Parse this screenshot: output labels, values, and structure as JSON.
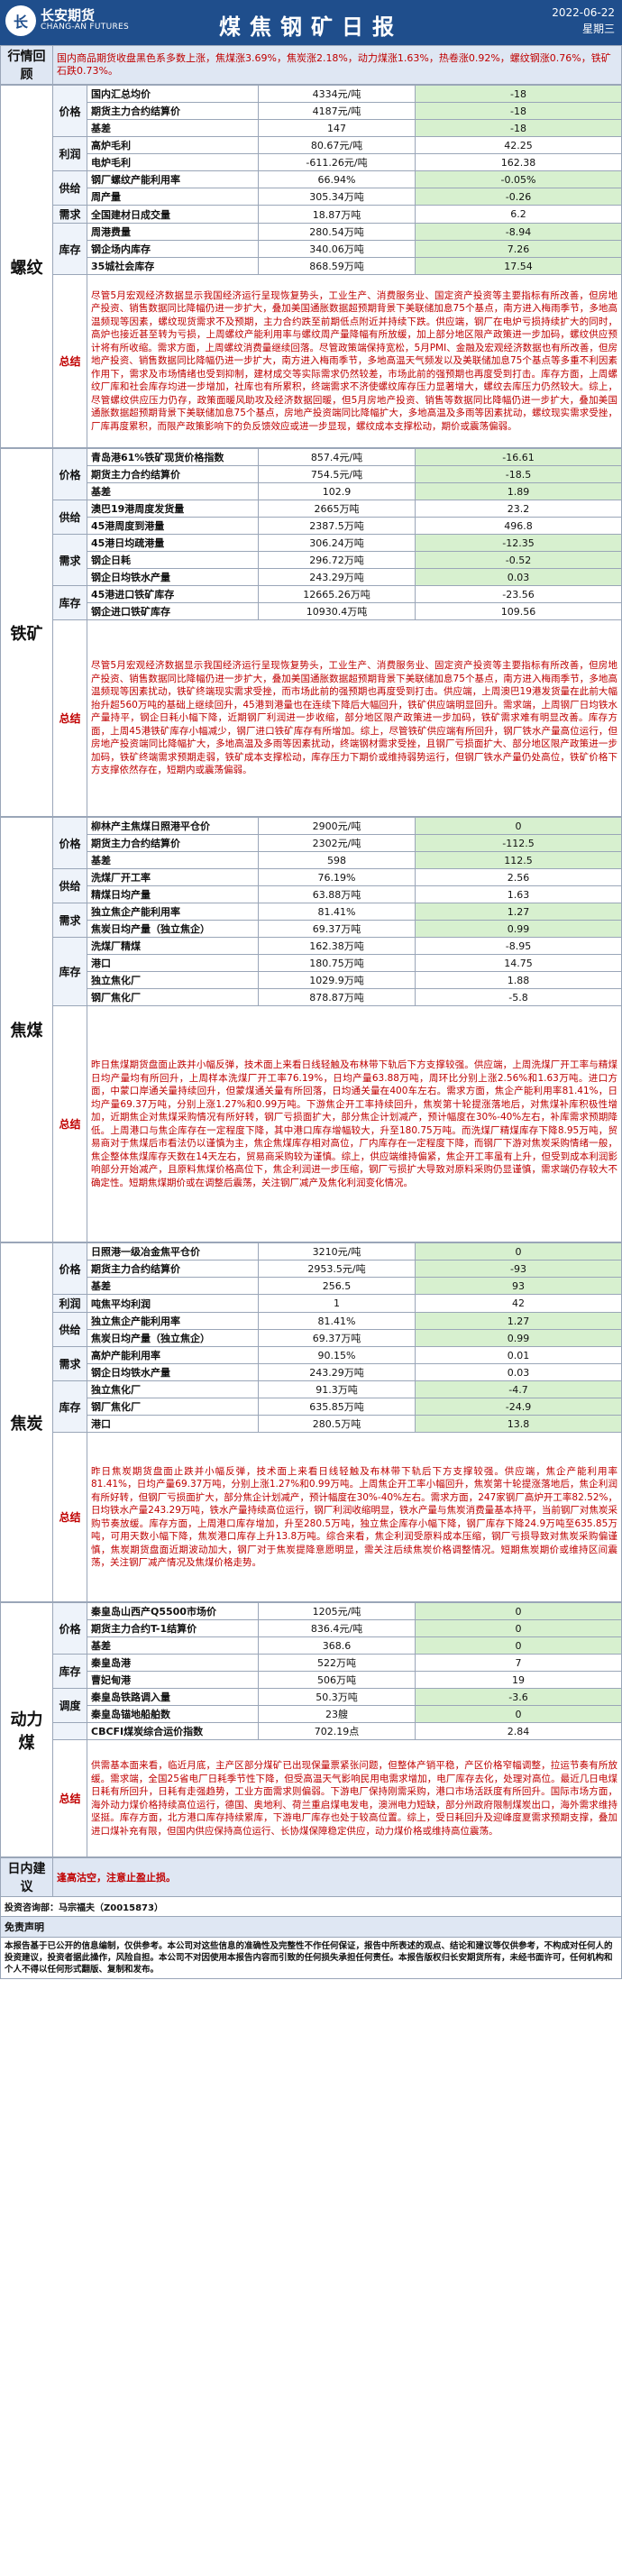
{
  "header": {
    "logo_mark": "长",
    "logo_cn": "长安期货",
    "logo_en": "CHANG-AN FUTURES",
    "title": "煤焦钢矿日报",
    "date": "2022-06-22",
    "weekday": "星期三"
  },
  "review": {
    "label": "行情回顾",
    "text": "国内商品期货收盘黑色系多数上涨，焦煤涨3.69%，焦炭涨2.18%，动力煤涨1.63%，热卷涨0.92%，螺纹钢涨0.76%，铁矿石跌0.73%。"
  },
  "sections": [
    {
      "name": "螺纹",
      "groups": [
        {
          "label": "价格",
          "rows": [
            {
              "item": "国内汇总均价",
              "value": "4334元/吨",
              "change": "-18"
            },
            {
              "item": "期货主力合约结算价",
              "value": "4187元/吨",
              "change": "-18"
            },
            {
              "item": "基差",
              "value": "147",
              "change": "-18"
            }
          ]
        },
        {
          "label": "利润",
          "rows": [
            {
              "item": "高炉毛利",
              "value": "80.67元/吨",
              "change": "42.25"
            },
            {
              "item": "电炉毛利",
              "value": "-611.26元/吨",
              "change": "162.38"
            }
          ]
        },
        {
          "label": "供给",
          "rows": [
            {
              "item": "钢厂螺纹产能利用率",
              "value": "66.94%",
              "change": "-0.05%"
            },
            {
              "item": "周产量",
              "value": "305.34万吨",
              "change": "-0.26"
            }
          ]
        },
        {
          "label": "需求",
          "rows": [
            {
              "item": "全国建材日成交量",
              "value": "18.87万吨",
              "change": "6.2"
            }
          ]
        },
        {
          "label": "库存",
          "rows": [
            {
              "item": "周港费量",
              "value": "280.54万吨",
              "change": "-8.94"
            },
            {
              "item": "钢企场内库存",
              "value": "340.06万吨",
              "change": "7.26"
            },
            {
              "item": "35城社会库存",
              "value": "868.59万吨",
              "change": "17.54"
            }
          ]
        }
      ],
      "summary_label": "总结",
      "summary": "尽管5月宏观经济数据显示我国经济运行呈现恢复势头，工业生产、消费服务业、国定资产投资等主要指标有所改善，但房地产投资、销售数据同比降幅仍进一步扩大，叠加美国通胀数据超预期背景下美联储加息75个基点，南方进入梅雨季节，多地高温频现等因素，螺纹现货需求不及预期，主力合约跌至前期低点附近并持续下跌。供应端，钢厂在电炉亏损持续扩大的同时，高炉也接近甚至转为亏损，上周螺纹产能利用率与螺纹周产量降幅有所放缓，加上部分地区限产政策进一步加码，螺纹供应预计将有所收缩。需求方面，上周螺纹消费量继续回落。尽管政策端保持宽松，5月PMI、金融及宏观经济数据也有所改善，但房地产投资、销售数据同比降幅仍进一步扩大，南方进入梅雨季节，多地高温天气频发以及美联储加息75个基点等多重不利因素作用下，需求及市场情绪也受到抑制，建材成交等实际需求仍然较差，市场此前的强预期也再度受到打击。库存方面，上周螺纹厂库和社会库存均进一步增加，社库也有所累积，终端需求不济使螺纹库存压力显著增大，螺纹去库压力仍然较大。综上，尽管螺纹供应压力仍存，政策面暖风助攻及经济数据回暖，但5月房地产投资、销售等数据同比降幅仍进一步扩大，叠加美国通胀数据超预期背景下美联储加息75个基点，房地产投资端同比降幅扩大，多地高温及多雨等因素扰动，螺纹现实需求受挫，厂库再度累积，而限产政策影响下的负反馈效应或进一步显现，螺纹成本支撑松动，期价或震荡偏弱。"
    },
    {
      "name": "铁矿",
      "groups": [
        {
          "label": "价格",
          "rows": [
            {
              "item": "青岛港61%铁矿现货价格指数",
              "value": "857.4元/吨",
              "change": "-16.61"
            },
            {
              "item": "期货主力合约结算价",
              "value": "754.5元/吨",
              "change": "-18.5"
            },
            {
              "item": "基差",
              "value": "102.9",
              "change": "1.89"
            }
          ]
        },
        {
          "label": "供给",
          "rows": [
            {
              "item": "澳巴19港周度发货量",
              "value": "2665万吨",
              "change": "23.2"
            },
            {
              "item": "45港周度到港量",
              "value": "2387.5万吨",
              "change": "496.8"
            }
          ]
        },
        {
          "label": "需求",
          "rows": [
            {
              "item": "45港日均疏港量",
              "value": "306.24万吨",
              "change": "-12.35"
            },
            {
              "item": "钢企日耗",
              "value": "296.72万吨",
              "change": "-0.52"
            },
            {
              "item": "钢企日均铁水产量",
              "value": "243.29万吨",
              "change": "0.03"
            }
          ]
        },
        {
          "label": "库存",
          "rows": [
            {
              "item": "45港进口铁矿库存",
              "value": "12665.26万吨",
              "change": "-23.56"
            },
            {
              "item": "钢企进口铁矿库存",
              "value": "10930.4万吨",
              "change": "109.56"
            }
          ]
        }
      ],
      "summary_label": "总结",
      "summary": "尽管5月宏观经济数据显示我国经济运行呈现恢复势头，工业生产、消费服务业、固定资产投资等主要指标有所改善，但房地产投资、销售数据同比降幅仍进一步扩大，叠加美国通胀数据超预期背景下美联储加息75个基点，南方进入梅雨季节，多地高温频现等因素扰动，铁矿终端现实需求受挫，而市场此前的强预期也再度受到打击。供应端，上周澳巴19港发货量在此前大幅抬升超560万吨的基础上继续回升，45港到港量也在连续下降后大幅回升，铁矿供应端明显回升。需求端，上周钢厂日均铁水产量持平，钢企日耗小幅下降，近期钢厂利润进一步收缩，部分地区限产政策进一步加码，铁矿需求难有明显改善。库存方面，上周45港铁矿库存小幅减少，钢厂进口铁矿库存有所增加。综上，尽管铁矿供应端有所回升，钢厂铁水产量高位运行，但房地产投资端同比降幅扩大，多地高温及多雨等因素扰动，终端钢材需求受挫，且钢厂亏损面扩大、部分地区限产政策进一步加码，铁矿终端需求预期走弱，铁矿成本支撑松动，库存压力下期价或维持弱势运行，但钢厂铁水产量仍处高位，铁矿价格下方支撑依然存在，短期内或震荡偏弱。"
    },
    {
      "name": "焦煤",
      "groups": [
        {
          "label": "价格",
          "rows": [
            {
              "item": "柳林产主焦煤日照港平仓价",
              "value": "2900元/吨",
              "change": "0"
            },
            {
              "item": "期货主力合约结算价",
              "value": "2302元/吨",
              "change": "-112.5"
            },
            {
              "item": "基差",
              "value": "598",
              "change": "112.5"
            }
          ]
        },
        {
          "label": "供给",
          "rows": [
            {
              "item": "洗煤厂开工率",
              "value": "76.19%",
              "change": "2.56"
            },
            {
              "item": "精煤日均产量",
              "value": "63.88万吨",
              "change": "1.63"
            }
          ]
        },
        {
          "label": "需求",
          "rows": [
            {
              "item": "独立焦企产能利用率",
              "value": "81.41%",
              "change": "1.27"
            },
            {
              "item": "焦炭日均产量（独立焦企）",
              "value": "69.37万吨",
              "change": "0.99"
            }
          ]
        },
        {
          "label": "库存",
          "rows": [
            {
              "item": "洗煤厂精煤",
              "value": "162.38万吨",
              "change": "-8.95"
            },
            {
              "item": "港口",
              "value": "180.75万吨",
              "change": "14.75"
            },
            {
              "item": "独立焦化厂",
              "value": "1029.9万吨",
              "change": "1.88"
            },
            {
              "item": "钢厂焦化厂",
              "value": "878.87万吨",
              "change": "-5.8"
            }
          ]
        }
      ],
      "summary_label": "总结",
      "summary": "昨日焦煤期货盘面止跌并小幅反弹，技术面上来看日线轻触及布林带下轨后下方支撑较强。供应端，上周洗煤厂开工率与精煤日均产量均有所回升，上周样本洗煤厂开工率76.19%，日均产量63.88万吨，周环比分别上涨2.56%和1.63万吨。进口方面，中蒙口岸通关量持续回升，但蒙煤通关量有所回落，日均通关量在400车左右。需求方面，焦企产能利用率81.41%，日均产量69.37万吨，分别上涨1.27%和0.99万吨。下游焦企开工率持续回升，焦炭第十轮提涨落地后，对焦煤补库积极性增加，近期焦企对焦煤采购情况有所好转，钢厂亏损面扩大，部分焦企计划减产，预计幅度在30%-40%左右，补库需求预期降低。上周港口与焦企库存在一定程度下降，其中港口库存增幅较大，升至180.75万吨。而洗煤厂精煤库存下降8.95万吨，贸易商对于焦煤后市看法仍以谨慎为主，焦企焦煤库存相对高位，厂内库存在一定程度下降，而钢厂下游对焦炭采购情绪一般，焦企整体焦煤库存天数在14天左右，贸易商采购较为谨慎。综上，供应端维持偏紧，焦企开工率虽有上升，但受到成本利润影响部分开始减产，且原料焦煤价格高位下，焦企利润进一步压缩，钢厂亏损扩大导致对原料采购仍显谨慎，需求端仍存较大不确定性。短期焦煤期价或在调整后震荡，关注钢厂减产及焦化利润变化情况。"
    },
    {
      "name": "焦炭",
      "groups": [
        {
          "label": "价格",
          "rows": [
            {
              "item": "日照港一级冶金焦平仓价",
              "value": "3210元/吨",
              "change": "0"
            },
            {
              "item": "期货主力合约结算价",
              "value": "2953.5元/吨",
              "change": "-93"
            },
            {
              "item": "基差",
              "value": "256.5",
              "change": "93"
            }
          ]
        },
        {
          "label": "利润",
          "rows": [
            {
              "item": "吨焦平均利润",
              "value": "1",
              "change": "42"
            }
          ]
        },
        {
          "label": "供给",
          "rows": [
            {
              "item": "独立焦企产能利用率",
              "value": "81.41%",
              "change": "1.27"
            },
            {
              "item": "焦炭日均产量（独立焦企）",
              "value": "69.37万吨",
              "change": "0.99"
            }
          ]
        },
        {
          "label": "需求",
          "rows": [
            {
              "item": "高炉产能利用率",
              "value": "90.15%",
              "change": "0.01"
            },
            {
              "item": "钢企日均铁水产量",
              "value": "243.29万吨",
              "change": "0.03"
            }
          ]
        },
        {
          "label": "库存",
          "rows": [
            {
              "item": "独立焦化厂",
              "value": "91.3万吨",
              "change": "-4.7"
            },
            {
              "item": "钢厂焦化厂",
              "value": "635.85万吨",
              "change": "-24.9"
            },
            {
              "item": "港口",
              "value": "280.5万吨",
              "change": "13.8"
            }
          ]
        }
      ],
      "summary_label": "总结",
      "summary": "昨日焦炭期货盘面止跌并小幅反弹，技术面上来看日线轻触及布林带下轨后下方支撑较强。供应端，焦企产能利用率81.41%，日均产量69.37万吨，分别上涨1.27%和0.99万吨。上周焦企开工率小幅回升，焦炭第十轮提涨落地后，焦企利润有所好转，但钢厂亏损面扩大，部分焦企计划减产，预计幅度在30%-40%左右。需求方面，247家钢厂高炉开工率82.52%，日均铁水产量243.29万吨，铁水产量持续高位运行，钢厂利润收缩明显，铁水产量与焦炭消费量基本持平，当前钢厂对焦炭采购节奏放缓。库存方面，上周港口库存增加，升至280.5万吨，独立焦企库存小幅下降，钢厂库存下降24.9万吨至635.85万吨，可用天数小幅下降，焦炭港口库存上升13.8万吨。综合来看，焦企利润受原料成本压缩，钢厂亏损导致对焦炭采购偏谨慎，焦炭期货盘面近期波动加大，钢厂对于焦炭提降意愿明显，需关注后续焦炭价格调整情况。短期焦炭期价或维持区间震荡，关注钢厂减产情况及焦煤价格走势。"
    },
    {
      "name": "动力煤",
      "groups": [
        {
          "label": "价格",
          "rows": [
            {
              "item": "秦皇岛山西产Q5500市场价",
              "value": "1205元/吨",
              "change": "0"
            },
            {
              "item": "期货主力合约T-1结算价",
              "value": "836.4元/吨",
              "change": "0"
            },
            {
              "item": "基差",
              "value": "368.6",
              "change": "0"
            }
          ]
        },
        {
          "label": "库存",
          "rows": [
            {
              "item": "秦皇岛港",
              "value": "522万吨",
              "change": "7"
            },
            {
              "item": "曹妃甸港",
              "value": "506万吨",
              "change": "19"
            }
          ]
        },
        {
          "label": "调度",
          "rows": [
            {
              "item": "秦皇岛铁路调入量",
              "value": "50.3万吨",
              "change": "-3.6"
            },
            {
              "item": "秦皇岛锚地船舶数",
              "value": "23艘",
              "change": "0"
            }
          ]
        },
        {
          "label": "",
          "rows": [
            {
              "item": "CBCFI煤炭综合运价指数",
              "value": "702.19点",
              "change": "2.84"
            }
          ]
        }
      ],
      "summary_label": "总结",
      "summary": "供需基本面来看，临近月底，主产区部分煤矿已出现保量票紧张问题，但整体产销平稳，产区价格窄幅调整，拉运节奏有所放缓。需求端，全国25省电厂日耗季节性下降，但受高温天气影响民用电需求增加，电厂库存去化，处理对高位。最近几日电煤日耗有所回升，日耗有走强趋势，工业方面需求则偏弱。下游电厂保持刚需采购，港口市场活跃度有所回升。国际市场方面，海外动力煤价格持续高位运行，德国、奥地利、荷兰重启煤电发电，澳洲电力短缺，部分州政府限制煤炭出口，海外需求维持坚挺。库存方面，北方港口库存持续累库，下游电厂库存也处于较高位置。综上，受日耗回升及迎峰度夏需求预期支撑，叠加进口煤补充有限，但国内供应保持高位运行、长协煤保障稳定供应，动力煤价格或维持高位震荡。"
    }
  ],
  "suggestion": {
    "label": "日内建议",
    "text": "逢高沽空，注意止盈止损。"
  },
  "contact": "投资咨询部：马宗福夫（Z0015873）",
  "disclaimer": {
    "title": "免责声明",
    "text": "本报告基于已公开的信息编制，仅供参考。本公司对这些信息的准确性及完整性不作任何保证，报告中所表述的观点、结论和建议等仅供参考，不构成对任何人的投资建议，投资者据此操作，风险自担。本公司不对因使用本报告内容而引致的任何损失承担任何责任。本报告版权归长安期货所有，未经书面许可，任何机构和个人不得以任何形式翻版、复制和发布。"
  }
}
